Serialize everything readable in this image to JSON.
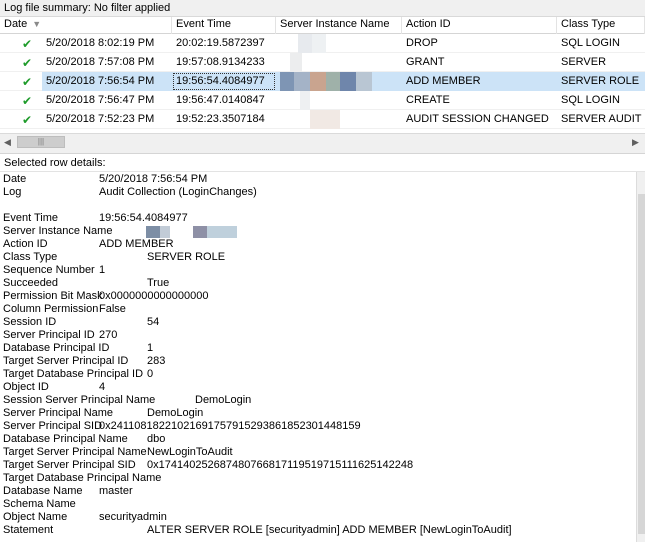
{
  "summary": {
    "text": "Log file summary: No filter applied"
  },
  "grid": {
    "columns": [
      {
        "label": "Date",
        "name": "col-date"
      },
      {
        "label": "Event Time",
        "name": "col-event-time"
      },
      {
        "label": "Server Instance Name",
        "name": "col-server-instance-name"
      },
      {
        "label": "Action ID",
        "name": "col-action-id"
      },
      {
        "label": "Class Type",
        "name": "col-class-type"
      }
    ],
    "sort_icon": "sort-descending-icon",
    "rows": [
      {
        "date": "5/20/2018 8:02:19 PM",
        "time": "20:02:19.5872397",
        "action": "DROP",
        "class": "SQL LOGIN"
      },
      {
        "date": "5/20/2018 7:57:08 PM",
        "time": "19:57:08.9134233",
        "action": "GRANT",
        "class": "SERVER"
      },
      {
        "date": "5/20/2018 7:56:54 PM",
        "time": "19:56:54.4084977",
        "action": "ADD MEMBER",
        "class": "SERVER ROLE"
      },
      {
        "date": "5/20/2018 7:56:47 PM",
        "time": "19:56:47.0140847",
        "action": "CREATE",
        "class": "SQL LOGIN"
      },
      {
        "date": "5/20/2018 7:52:23 PM",
        "time": "19:52:23.3507184",
        "action": "AUDIT SESSION CHANGED",
        "class": "SERVER AUDIT"
      }
    ],
    "selected_row": 2,
    "status_icon": "checkmark-icon",
    "status_glyph": "✔",
    "accent_color": "#cce3f7",
    "check_color": "#1e9b2a"
  },
  "scrollbar": {
    "left_arrow": "◀",
    "right_arrow": "▶",
    "thumb_grip": "|||"
  },
  "details": {
    "title": "Selected row details:",
    "fields": [
      {
        "label": "Date",
        "value": "5/20/2018 7:56:54 PM"
      },
      {
        "label": "Log",
        "value": "Audit Collection (LoginChanges)"
      },
      {
        "label": "",
        "value": ""
      },
      {
        "label": "Event Time",
        "value": "19:56:54.4084977"
      },
      {
        "label": "Server Instance Name",
        "value": ""
      },
      {
        "label": "Action ID",
        "value": "ADD MEMBER"
      },
      {
        "label": "Class Type",
        "value": "SERVER ROLE"
      },
      {
        "label": "Sequence Number",
        "value": "1"
      },
      {
        "label": "Succeeded",
        "value": "True"
      },
      {
        "label": "Permission Bit Mask",
        "value": "0x0000000000000000"
      },
      {
        "label": "Column Permission",
        "value": "False"
      },
      {
        "label": "Session ID",
        "value": "54"
      },
      {
        "label": "Server Principal ID",
        "value": "270"
      },
      {
        "label": "Database Principal ID",
        "value": "1"
      },
      {
        "label": "Target Server Principal ID",
        "value": "283"
      },
      {
        "label": "Target Database Principal ID",
        "value": "0"
      },
      {
        "label": "Object ID",
        "value": "4"
      },
      {
        "label": "Session Server Principal Name",
        "value": "DemoLogin"
      },
      {
        "label": "Server Principal Name",
        "value": "DemoLogin"
      },
      {
        "label": "Server Principal SID",
        "value": "0x241108182210216917579152938618523014481​59"
      },
      {
        "label": "Database Principal Name",
        "value": "dbo"
      },
      {
        "label": "Target Server Principal Name",
        "value": "NewLoginToAudit"
      },
      {
        "label": "Target Server Principal SID",
        "value": "0x174140252687480766817119519715111625142248"
      },
      {
        "label": "Target Database Principal Name",
        "value": ""
      },
      {
        "label": "Database Name",
        "value": "master"
      },
      {
        "label": "Schema Name",
        "value": ""
      },
      {
        "label": "Object Name",
        "value": "securityadmin"
      },
      {
        "label": "Statement",
        "value": "ALTER SERVER ROLE [securityadmin] ADD MEMBER [NewLoginToAudit]"
      }
    ]
  }
}
